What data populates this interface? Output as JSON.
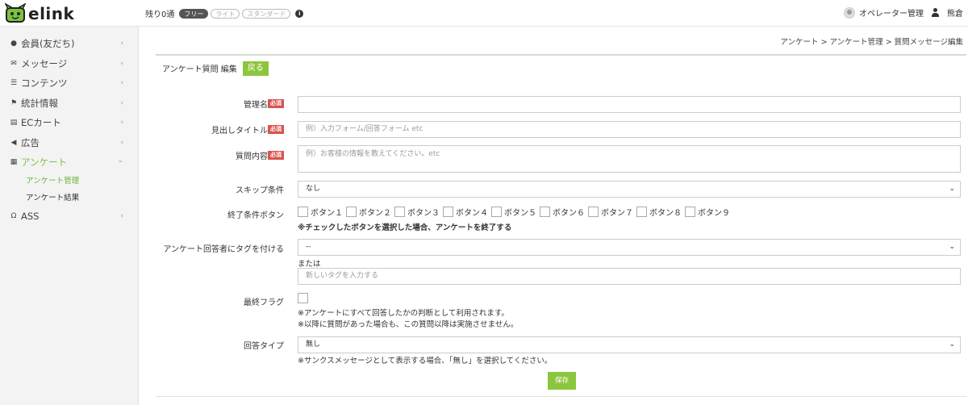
{
  "header": {
    "logo_text": "elink",
    "quota_text": "残り0通",
    "plans": [
      "フリー",
      "ライト",
      "スタンダード"
    ],
    "info_icon": "info-icon",
    "user_role": "オペレーター管理",
    "user_name": "熊倉"
  },
  "sidebar": {
    "items": [
      {
        "label": "会員(友だち)",
        "icon": "user-icon"
      },
      {
        "label": "メッセージ",
        "icon": "envelope-icon"
      },
      {
        "label": "コンテンツ",
        "icon": "list-icon"
      },
      {
        "label": "統計情報",
        "icon": "flag-icon"
      },
      {
        "label": "ECカート",
        "icon": "cart-icon"
      },
      {
        "label": "広告",
        "icon": "megaphone-icon"
      },
      {
        "label": "アンケート",
        "icon": "survey-icon"
      },
      {
        "label": "ASS",
        "icon": "headset-icon"
      }
    ],
    "subitems": [
      "アンケート管理",
      "アンケート結果"
    ]
  },
  "breadcrumb": "アンケート > アンケート管理 > 質問メッセージ編集",
  "panel": {
    "title": "アンケート質問 編集",
    "back_label": "戻る"
  },
  "form": {
    "required_badge": "必須",
    "admin_name_label": "管理名",
    "admin_name_value": "",
    "heading_label": "見出しタイトル",
    "heading_placeholder": "例）入力フォーム/回答フォーム etc",
    "question_label": "質問内容",
    "question_placeholder": "例）お客様の情報を教えてください。etc",
    "skip_label": "スキップ条件",
    "skip_value": "なし",
    "end_button_label": "終了条件ボタン",
    "end_buttons": [
      "ボタン１",
      "ボタン２",
      "ボタン３",
      "ボタン４",
      "ボタン５",
      "ボタン６",
      "ボタン７",
      "ボタン８",
      "ボタン９"
    ],
    "end_note": "※チェックしたボタンを選択した場合、アンケートを終了する",
    "tag_label": "アンケート回答者にタグを付ける",
    "tag_value": "--",
    "or_text": "または",
    "new_tag_placeholder": "新しいタグを入力する",
    "final_flag_label": "最終フラグ",
    "final_note_1": "※アンケートにすべて回答したかの判断として利用されます。",
    "final_note_2": "※以降に質問があった場合も、この質問以降は実施させません。",
    "answer_type_label": "回答タイプ",
    "answer_type_value": "無し",
    "answer_type_note": "※サンクスメッセージとして表示する場合、「無し」を選択してください。",
    "save_label": "保存"
  }
}
